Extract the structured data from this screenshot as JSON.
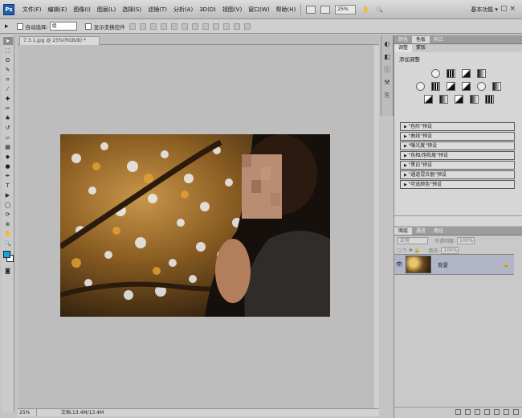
{
  "app": {
    "logo": "Ps"
  },
  "menu": {
    "items": [
      "文件(F)",
      "编辑(E)",
      "图像(I)",
      "图层(L)",
      "选择(S)",
      "滤镜(T)",
      "分析(A)",
      "3D(D)",
      "视图(V)",
      "窗口(W)",
      "帮助(H)"
    ],
    "zoom": "25%",
    "workspace": "基本功能 ▾"
  },
  "options": {
    "tool_icon": "▸",
    "auto_select_label": "自动选择:",
    "auto_select_value": "组",
    "show_transform_label": "显示变换控件"
  },
  "document": {
    "tab_label": "7.3.1.jpg @ 25%(RGB/8) *",
    "zoom": "25%",
    "doc_info": "文档:13.4M/13.4M"
  },
  "panels": {
    "top_tabs": [
      "颜色",
      "色板",
      "样式"
    ],
    "adjust_tabs": [
      "调整",
      "蒙版"
    ],
    "adjust_title": "添加调整",
    "presets": [
      "\"色阶\"预设",
      "\"曲线\"预设",
      "\"曝光度\"预设",
      "\"色相/饱和度\"预设",
      "\"黑白\"预设",
      "\"通道混合器\"预设",
      "\"可选颜色\"预设"
    ],
    "layer_tabs": [
      "图层",
      "通道",
      "路径"
    ],
    "blend_mode": "正常",
    "opacity_label": "不透明度:",
    "opacity_value": "100%",
    "fill_label": "填充:",
    "fill_value": "100%",
    "layer_name": "背景"
  },
  "colors": {
    "foreground": "#12a7d6",
    "background": "#ffffff",
    "layer_selected": "#b2b5c8"
  }
}
